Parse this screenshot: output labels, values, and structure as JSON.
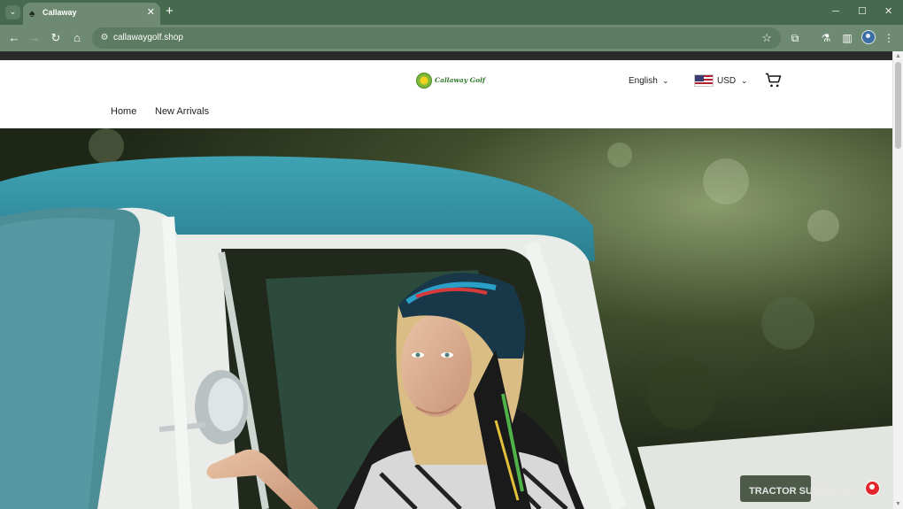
{
  "browser": {
    "tab_title": "Callaway",
    "url": "callawaygolf.shop",
    "tab_close_glyph": "✕",
    "new_tab_glyph": "+"
  },
  "header": {
    "logo_text": "Callaway Golf",
    "language": "English",
    "currency": "USD"
  },
  "nav": {
    "items": [
      {
        "label": "Home"
      },
      {
        "label": "New Arrivals"
      }
    ]
  },
  "hero": {
    "sign_text": "TRACTOR SUPPLY Co"
  },
  "icons": {
    "tab_search": "chevron-down-icon",
    "favicon": "spade-icon",
    "back": "arrow-left-icon",
    "forward": "arrow-right-icon",
    "reload": "reload-icon",
    "home": "home-icon",
    "site_info": "tune-icon",
    "bookmark": "star-icon",
    "extensions": "puzzle-icon",
    "labs": "flask-icon",
    "side_panel": "side-panel-icon",
    "profile": "profile-avatar-icon",
    "menu": "kebab-menu-icon",
    "cart": "cart-icon",
    "chat": "chat-widget-icon"
  },
  "colors": {
    "chrome_dark": "#476a4e",
    "chrome_light": "#6e8a72",
    "logo_green": "#2f7a2a",
    "chat_red": "#e2262b"
  }
}
